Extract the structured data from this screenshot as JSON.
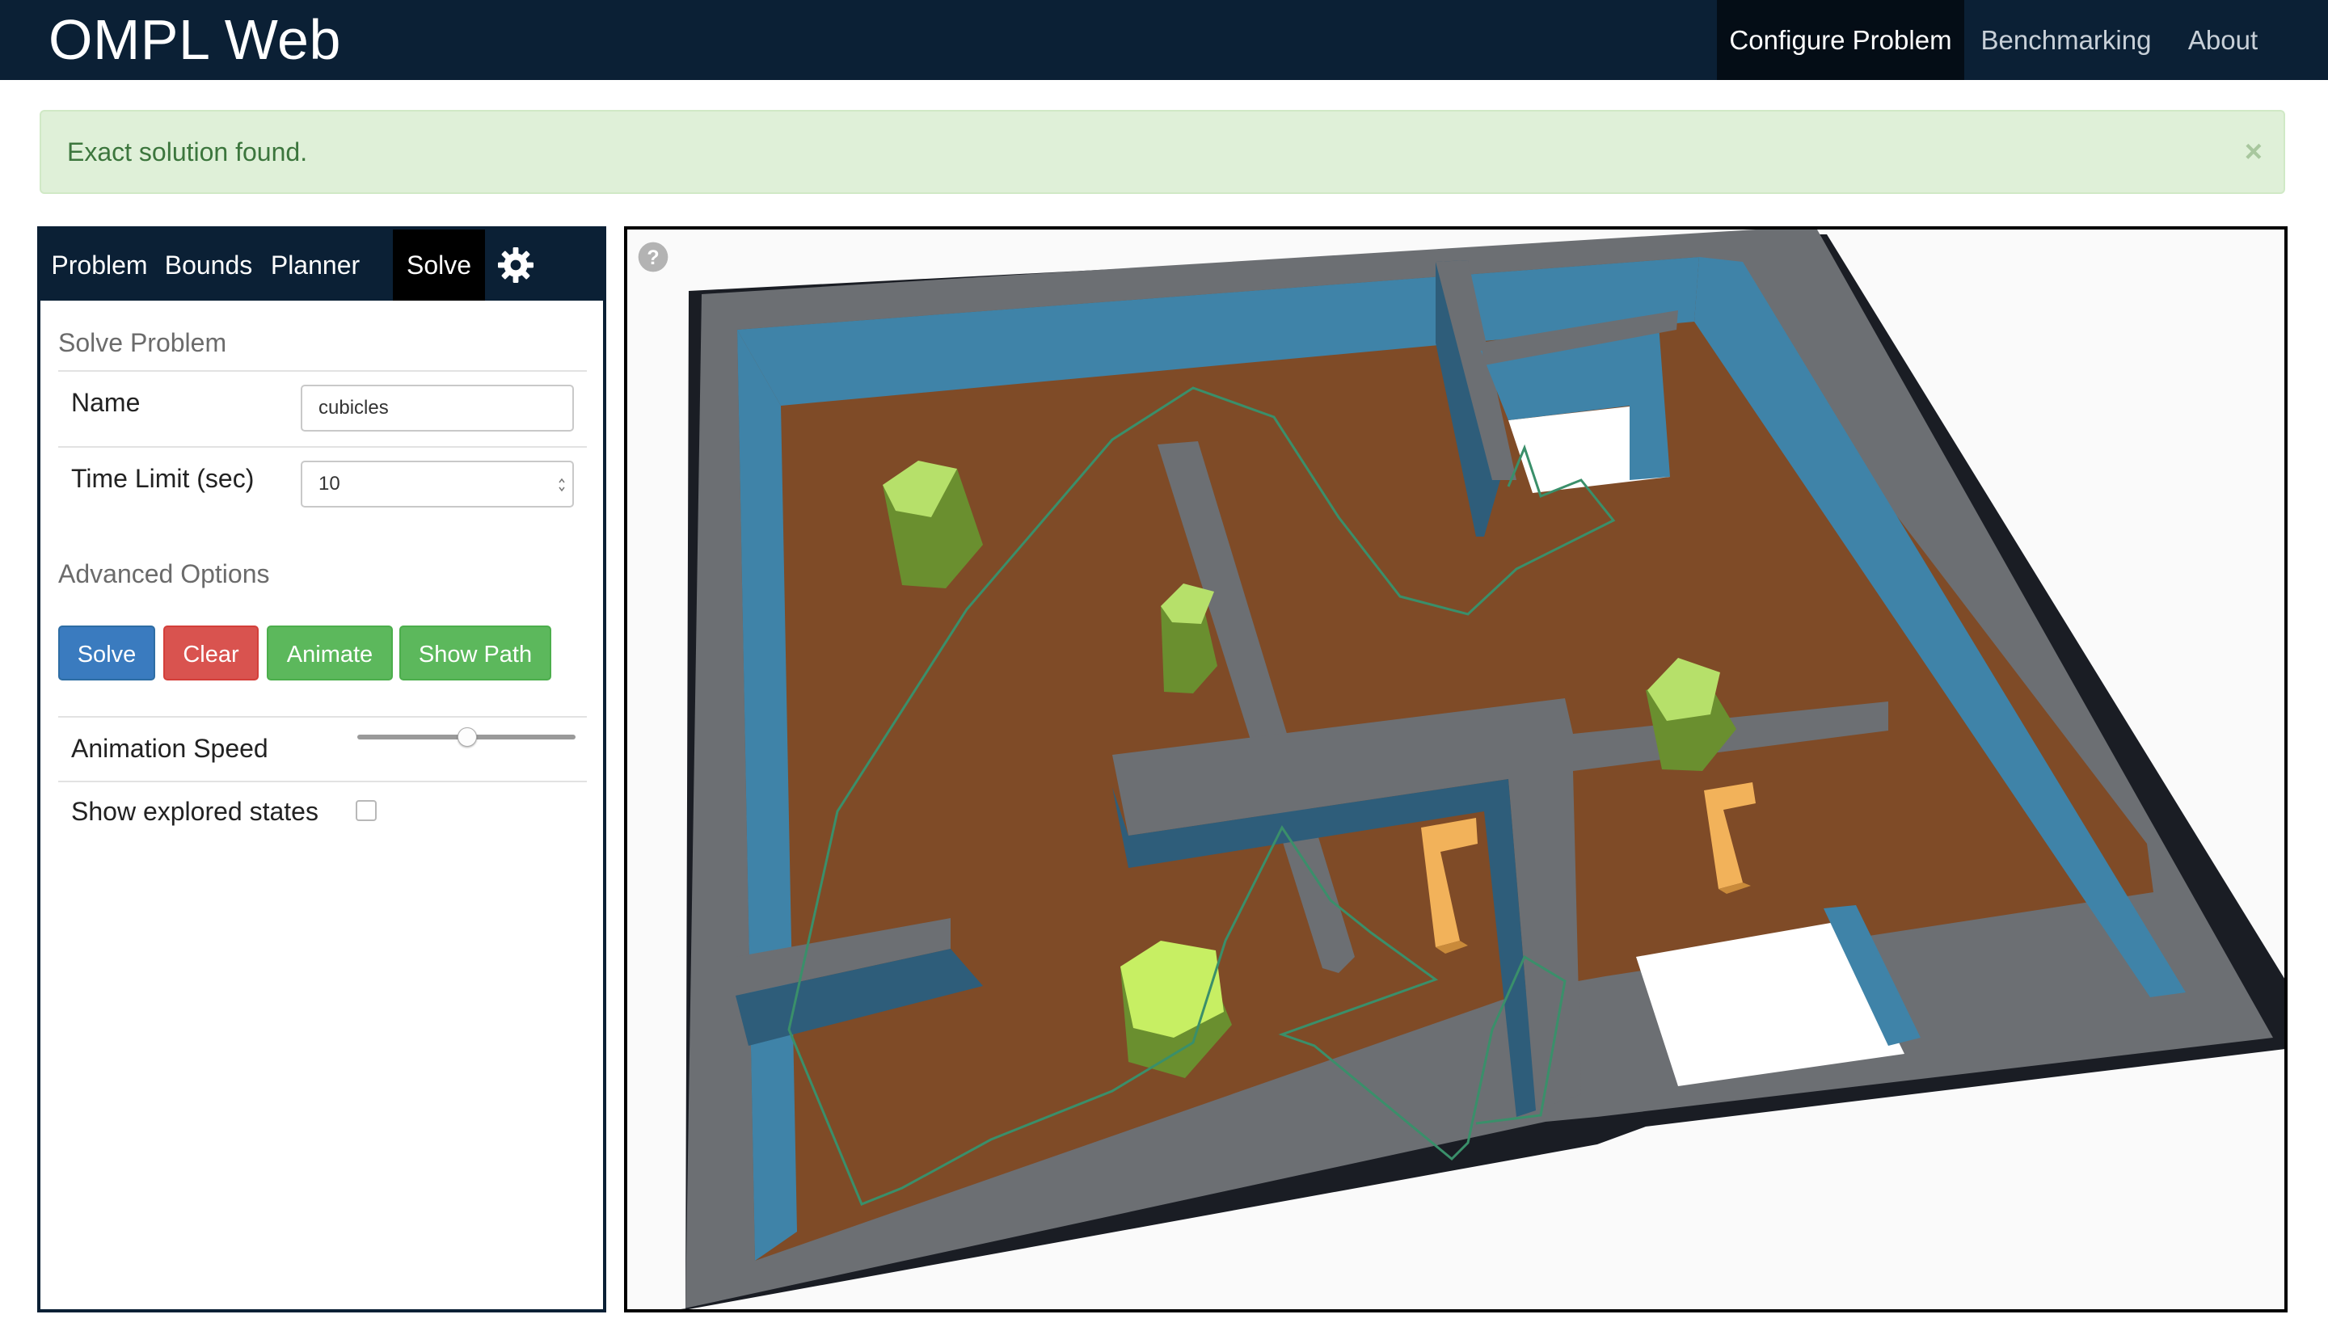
{
  "navbar": {
    "brand": "OMPL Web",
    "items": [
      {
        "label": "Configure Problem",
        "active": true
      },
      {
        "label": "Benchmarking",
        "active": false
      },
      {
        "label": "About",
        "active": false
      }
    ]
  },
  "alert": {
    "message": "Exact solution found.",
    "close": "×"
  },
  "panel": {
    "tabs": [
      {
        "label": "Problem"
      },
      {
        "label": "Bounds"
      },
      {
        "label": "Planner"
      },
      {
        "label": "Solve",
        "active": true
      }
    ],
    "settings_icon": "gear-icon",
    "solve_title": "Solve Problem",
    "name_label": "Name",
    "name_value": "cubicles",
    "time_limit_label": "Time Limit (sec)",
    "time_limit_value": "10",
    "advanced_title": "Advanced Options",
    "buttons": {
      "solve": "Solve",
      "clear": "Clear",
      "animate": "Animate",
      "show_path": "Show Path"
    },
    "animation_speed_label": "Animation Speed",
    "animation_speed_fraction": 0.5,
    "show_explored_label": "Show explored states",
    "show_explored_checked": false
  },
  "viewer": {
    "help_icon": "question-circle-icon",
    "colors": {
      "floor": "#7f4b27",
      "wall_top": "#6c6f73",
      "wall_side": "#3f83a8",
      "hexagon": "#9dcb57",
      "robot": "#f2b25a",
      "path": "#3a8f6a"
    }
  },
  "colors": {
    "navbar": "#0b2035",
    "alert_bg": "#dff0d8",
    "alert_text": "#3c763d",
    "primary": "#3a7bbf",
    "danger": "#d9534f",
    "success": "#5cb85c"
  }
}
